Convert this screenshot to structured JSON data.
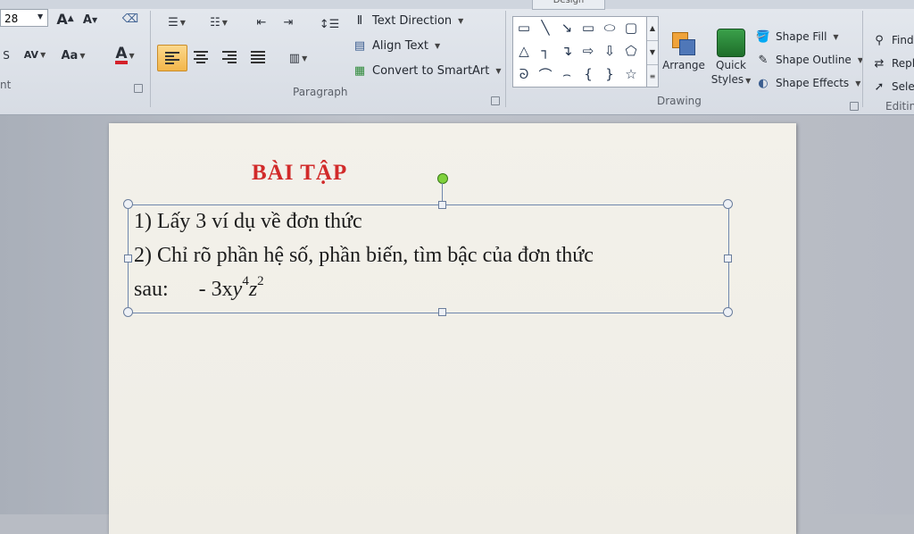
{
  "ribbon": {
    "contextual_tab": "Design",
    "font": {
      "size_value": "28",
      "group_label": "nt"
    },
    "paragraph": {
      "group_label": "Paragraph",
      "text_direction": "Text Direction",
      "align_text": "Align Text",
      "convert_smartart": "Convert to SmartArt"
    },
    "drawing": {
      "group_label": "Drawing",
      "arrange": "Arrange",
      "quick": "Quick",
      "styles": "Styles",
      "shape_fill": "Shape Fill",
      "shape_outline": "Shape Outline",
      "shape_effects": "Shape Effects"
    },
    "editing": {
      "group_label": "Editin",
      "find": "Find",
      "replace": "Repla",
      "select": "Selec"
    }
  },
  "slide": {
    "title": "BÀI TẬP",
    "line1": "1) Lấy 3 ví dụ về đơn thức",
    "line2": "2) Chỉ rõ phần hệ số, phần biến, tìm bậc của đơn thức",
    "line3_prefix": "sau:",
    "expr_coeff": "- 3x",
    "expr_y": "y",
    "expr_y_exp": "4",
    "expr_z": "z",
    "expr_z_exp": "2"
  },
  "colors": {
    "title": "#d12a2a",
    "selection_frame": "#6f87ad",
    "active_align": "#f3b64a"
  }
}
